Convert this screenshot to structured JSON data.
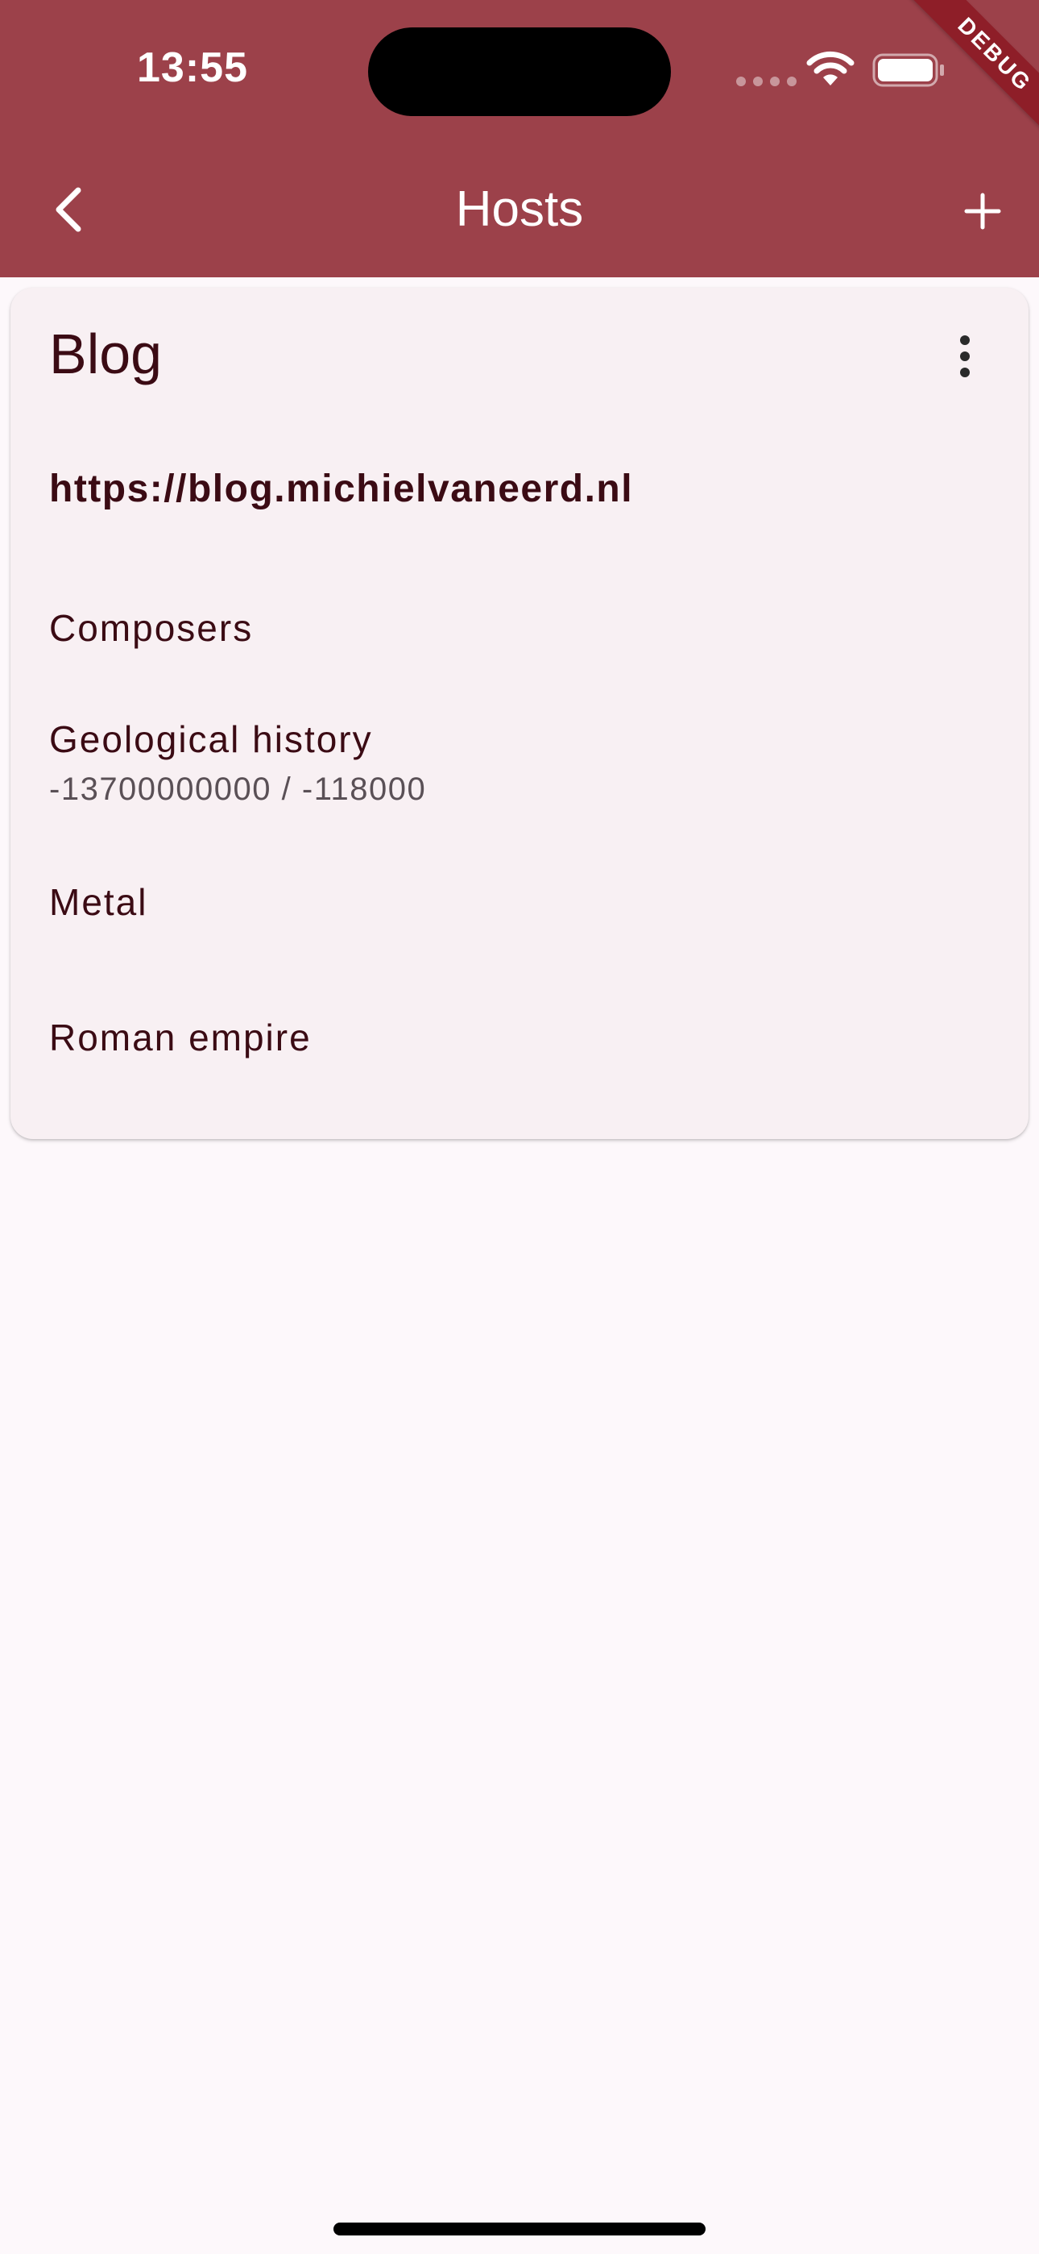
{
  "status_bar": {
    "time": "13:55"
  },
  "debug_banner": "DEBUG",
  "toolbar": {
    "title": "Hosts",
    "back_icon": "chevron-left-icon",
    "add_icon": "plus-icon"
  },
  "host_card": {
    "title": "Blog",
    "url": "https://blog.michielvaneerd.nl",
    "menu_icon": "more-vertical-icon",
    "items": [
      {
        "label": "Composers",
        "subtitle": ""
      },
      {
        "label": "Geological history",
        "subtitle": "-13700000000 / -118000"
      },
      {
        "label": "Metal",
        "subtitle": ""
      },
      {
        "label": "Roman empire",
        "subtitle": ""
      }
    ]
  },
  "colors": {
    "app_bar": "#9c414a",
    "card_background": "#f8f0f3",
    "page_background": "#fdf8fb",
    "text_primary": "#3b0b14"
  }
}
